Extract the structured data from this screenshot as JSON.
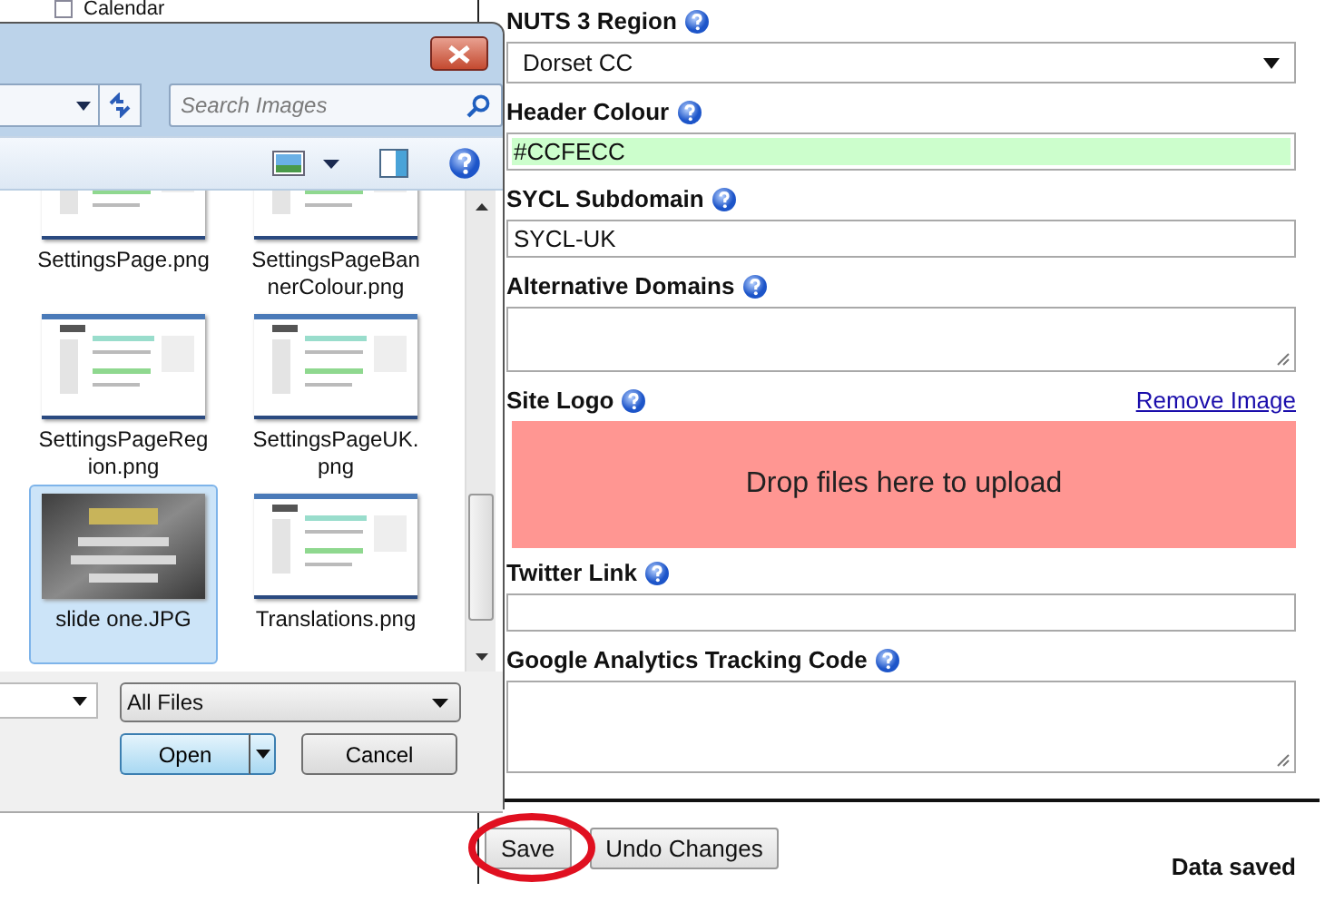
{
  "background_page": {
    "sidebar_items": [
      {
        "label": "Calendar"
      }
    ]
  },
  "form": {
    "fields": [
      {
        "kind": "select",
        "label": "NUTS 3 Region",
        "value": "Dorset CC"
      },
      {
        "kind": "text",
        "label": "Header Colour",
        "value": "#CCFECC",
        "color": "#ccfecc"
      },
      {
        "kind": "text",
        "label": "SYCL Subdomain",
        "value": "SYCL-UK"
      },
      {
        "kind": "textarea",
        "label": "Alternative Domains"
      },
      {
        "kind": "file",
        "label": "Site Logo",
        "link": "Remove Image",
        "dropzone": "Drop files here to upload"
      },
      {
        "kind": "text",
        "label": "Twitter Link"
      },
      {
        "kind": "bigtextarea",
        "label": "Google Analytics Tracking Code"
      }
    ],
    "buttons": [
      {
        "label": "Save",
        "highlighted": true
      },
      {
        "label": "Undo Changes",
        "highlighted": false
      }
    ],
    "status": "Data saved"
  },
  "file_dialog": {
    "search_placeholder": "Search Images",
    "files": [
      {
        "name": "SettingsPage.png",
        "selected": false,
        "kind": "screenshot"
      },
      {
        "name": "SettingsPageBannerColour.png",
        "selected": false,
        "kind": "screenshot"
      },
      {
        "name": "SettingsPageRegion.png",
        "selected": false,
        "kind": "screenshot"
      },
      {
        "name": "SettingsPageUK.png",
        "selected": false,
        "kind": "screenshot"
      },
      {
        "name": "slide one.JPG",
        "selected": true,
        "kind": "slide"
      },
      {
        "name": "Translations.png",
        "selected": false,
        "kind": "screenshot"
      }
    ],
    "file_type": "All Files",
    "open_label": "Open",
    "cancel_label": "Cancel"
  }
}
